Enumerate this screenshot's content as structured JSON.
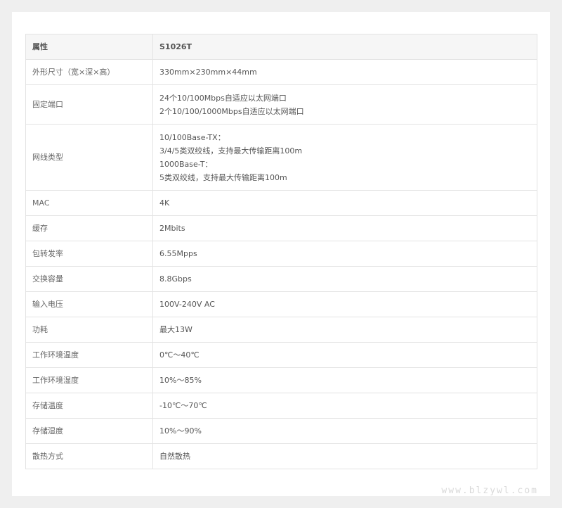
{
  "table": {
    "header": {
      "attr": "属性",
      "model": "S1026T"
    },
    "rows": [
      {
        "attr": "外形尺寸（宽×深×高）",
        "value": [
          "330mm×230mm×44mm"
        ]
      },
      {
        "attr": "固定端口",
        "value": [
          "24个10/100Mbps自适应以太网端口",
          "2个10/100/1000Mbps自适应以太网端口"
        ]
      },
      {
        "attr": "网线类型",
        "value": [
          "10/100Base-TX：",
          "3/4/5类双绞线，支持最大传输距离100m",
          "1000Base-T：",
          "5类双绞线，支持最大传输距离100m"
        ]
      },
      {
        "attr": "MAC",
        "value": [
          "4K"
        ]
      },
      {
        "attr": "缓存",
        "value": [
          "2Mbits"
        ]
      },
      {
        "attr": "包转发率",
        "value": [
          "6.55Mpps"
        ]
      },
      {
        "attr": "交换容量",
        "value": [
          "8.8Gbps"
        ]
      },
      {
        "attr": "输入电压",
        "value": [
          "100V-240V AC"
        ]
      },
      {
        "attr": "功耗",
        "value": [
          "最大13W"
        ]
      },
      {
        "attr": "工作环境温度",
        "value": [
          "0℃～40℃"
        ]
      },
      {
        "attr": "工作环境湿度",
        "value": [
          "10%～85%"
        ]
      },
      {
        "attr": "存储温度",
        "value": [
          "-10℃～70℃"
        ]
      },
      {
        "attr": "存储湿度",
        "value": [
          "10%～90%"
        ]
      },
      {
        "attr": "散热方式",
        "value": [
          "自然散热"
        ]
      }
    ]
  },
  "watermark": "www.blzywl.com"
}
